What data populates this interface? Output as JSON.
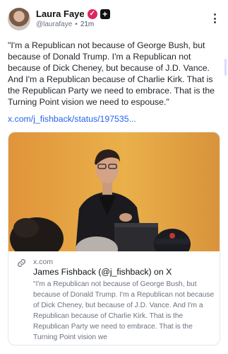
{
  "author": {
    "name": "Laura Faye",
    "handle": "@laurafaye",
    "separator": "•",
    "time": "21m",
    "verified_icon": "check-badge-icon",
    "plus_icon": "plus-badge-icon"
  },
  "post": {
    "text": "\"I'm a Republican not because of George Bush, but because of Donald Trump. I'm a Republican not because of Dick Cheney, but because of J.D. Vance. And I'm a Republican because of Charlie Kirk. That is the Republican Party we need to embrace. That is the Turning Point vision we need to espouse.\"",
    "link": "x.com/j_fishback/status/197535..."
  },
  "card": {
    "domain": "x.com",
    "title": "James Fishback (@j_fishback) on X",
    "description": "\"I'm a Republican not because of George Bush, but because of Donald Trump. I'm a Republican not because of Dick Cheney, but because of J.D. Vance. And I'm a Republican because of Charlie Kirk. That is the Republican Party we need to embrace. That is the Turning Point vision we",
    "link_icon": "link-icon"
  },
  "colors": {
    "accent": "#2563eb",
    "verified": "#e0245e",
    "image_wall": "#e6a13e"
  }
}
